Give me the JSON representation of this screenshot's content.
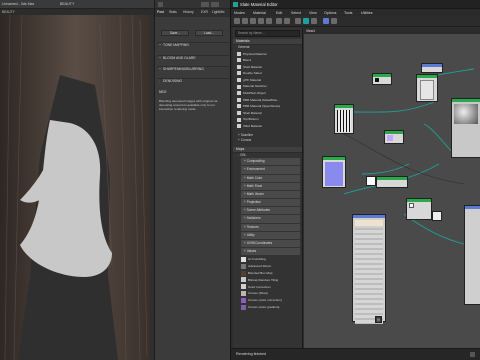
{
  "viewport": {
    "title": "Unnamed - 3ds Max",
    "top_label_left": "[+] [Camera] [Standard] [Default Shading]",
    "view_name": "BEAUTY",
    "bottom_label": "BEAUTY"
  },
  "render_panel": {
    "tabs": [
      "Post",
      "Stats",
      "History",
      "EXR",
      "LightMix"
    ],
    "active_tab": "Post",
    "buttons": [
      "Save...",
      "Load..."
    ],
    "sections": [
      "TONE MAPPING",
      "BLOOM AND GLARE",
      "SHARPENING/BLURRING",
      "DENOISING"
    ],
    "neo_label": "NEO",
    "description": "Blending denoised images with original via denoising amount is available only to run interactive rendering mode"
  },
  "slate": {
    "title": "Slate Material Editor",
    "menu": [
      "Modes",
      "Material",
      "Edit",
      "Select",
      "View",
      "Options",
      "Tools",
      "Utilities"
    ],
    "search_placeholder": "Search by Name ...",
    "view_tab": "View1",
    "status": "Rendering finished",
    "materials_header": "Materials",
    "general_label": "General",
    "materials": [
      "Physical Material",
      "Blend",
      "Shell Material",
      "Double Sided",
      "glTF Material",
      "Material Switcher",
      "Multi/Sub-Object",
      "PBR Material (Metal/Rou...",
      "PBR Material (Spec/Gloss)",
      "Shell Material",
      "Top/Bottom",
      "XRef Material"
    ],
    "scanline_label": "+ Scanline",
    "corona_label": "+ Corona",
    "maps_header": "Maps",
    "osl_label": "- OSL",
    "map_groups": [
      "+ Compositing",
      "+ Environment",
      "+ Math Color",
      "+ Math Float",
      "+ Math Vector",
      "+ Projection",
      "+ Scene Attributes",
      "+ Switchers",
      "+ Textures",
      "+ Utility",
      "+ UVW/Coordinates",
      "+ Values"
    ],
    "map_items": [
      "Ai Crumbling",
      "Advanced Wood",
      "Blended Box Map",
      "Bitmap Random Tiling",
      "Color Correction",
      "Curves (Float)",
      "Curves (color correction)",
      "Curves (color gradient)"
    ],
    "map_colors": [
      "#e0e0e0",
      "#777777",
      "#5a3f2e",
      "#c9c9c9",
      "#d0d0d0",
      "#b8b8b8",
      "#8c5fb8",
      "#7f5fa8"
    ]
  },
  "colors": {
    "accent": "#1fa19a",
    "node_green": "#2aa84a",
    "node_blue": "#5c7bd0",
    "node_lavender": "#8a89ee",
    "node_purple": "#9b7be0"
  }
}
